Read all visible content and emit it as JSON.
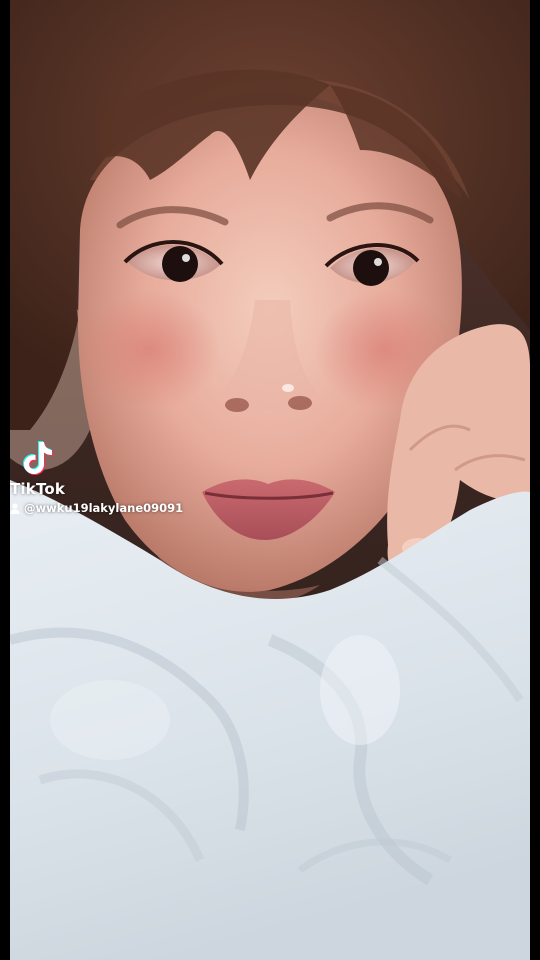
{
  "watermark": {
    "logo_icon": "tiktok-logo-icon",
    "brand": "TikTok",
    "user_icon": "user-icon",
    "handle": "@wwku19lakylane09091"
  },
  "colors": {
    "white": "#ffffff",
    "logo_cyan": "#25f4ee",
    "logo_red": "#fe2c55"
  }
}
